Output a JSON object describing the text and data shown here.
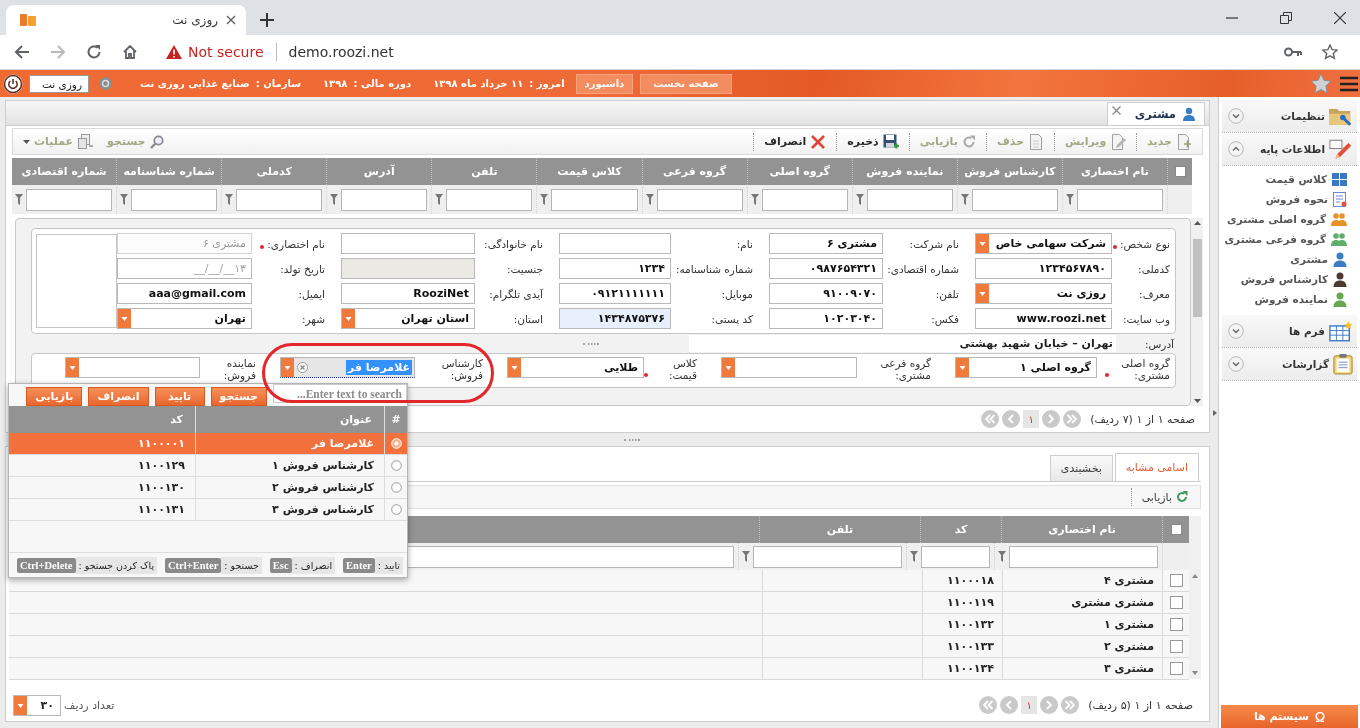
{
  "browser": {
    "tab_title": "روزی نت",
    "security": "Not secure",
    "url": "demo.roozi.net"
  },
  "header": {
    "buttons": [
      "صفحه نخست",
      "داشبورد"
    ],
    "info": [
      {
        "label": "امروز :",
        "value": "۱۱ خرداد ماه ۱۳۹۸"
      },
      {
        "label": "دوره مالی :",
        "value": "۱۳۹۸"
      },
      {
        "label": "سازمان :",
        "value": "صنایع غذایی روزی نت"
      }
    ],
    "company": "روزی نت"
  },
  "page_tab": {
    "label": "مشتری"
  },
  "toolbar": {
    "actions": [
      {
        "label": "جدید",
        "kind": "new",
        "disabled": true
      },
      {
        "label": "ویرایش",
        "kind": "edit",
        "disabled": true
      },
      {
        "label": "حذف",
        "kind": "delete",
        "disabled": true
      },
      {
        "label": "بازیابی",
        "kind": "restore",
        "disabled": true
      },
      {
        "label": "ذخیره",
        "kind": "save",
        "disabled": false
      },
      {
        "label": "انصراف",
        "kind": "cancel",
        "disabled": false
      }
    ],
    "tools": [
      {
        "label": "جستجو",
        "kind": "search",
        "disabled": true
      },
      {
        "label": "عملیات",
        "kind": "menu",
        "disabled": true
      }
    ]
  },
  "grid": {
    "all_checked": false,
    "columns": [
      "نام اختصاری",
      "کارشناس فروش",
      "نماینده فروش",
      "گروه اصلی",
      "گروه فرعی",
      "کلاس قیمت",
      "تلفن",
      "آدرس",
      "کدملی",
      "شماره شناسنامه",
      "شماره اقتصادی"
    ]
  },
  "form": {
    "rows": [
      [
        {
          "label": "نوع شخص:",
          "required": true,
          "kind": "select",
          "value": "شرکت سهامی خاص",
          "disabled": false,
          "autofilled": false
        },
        {
          "label": "نام شرکت:",
          "required": false,
          "kind": "text",
          "value": "مشتری ۶",
          "disabled": false,
          "autofilled": false
        },
        {
          "label": "نام:",
          "required": false,
          "kind": "text",
          "disabled": false,
          "autofilled": false
        },
        {
          "label": "نام خانوادگی:",
          "required": false,
          "kind": "text",
          "disabled": false,
          "autofilled": false
        },
        {
          "label": "نام اختصاری:",
          "required": true,
          "kind": "text",
          "value": "مشتری ۶",
          "disabled": true,
          "autofilled": false
        }
      ],
      [
        {
          "label": "کدملی:",
          "required": false,
          "kind": "text",
          "value": "۱۲۳۴۵۶۷۸۹۰",
          "disabled": false,
          "autofilled": false
        },
        {
          "label": "شماره اقتصادی:",
          "required": false,
          "kind": "text",
          "value": "۰۹۸۷۶۵۴۳۲۱",
          "disabled": false,
          "autofilled": false
        },
        {
          "label": "شماره شناسنامه:",
          "required": false,
          "kind": "text",
          "value": "۱۲۳۴",
          "disabled": false,
          "autofilled": false
        },
        {
          "label": "جنسیت:",
          "required": false,
          "kind": "select",
          "disabled": true,
          "autofilled": false
        },
        {
          "label": "تاریخ تولد:",
          "required": false,
          "kind": "text",
          "placeholder": "۱۳__/__/__",
          "disabled": false,
          "autofilled": false
        }
      ],
      [
        {
          "label": "معرف:",
          "required": false,
          "kind": "select",
          "value": "روزی نت",
          "disabled": false,
          "autofilled": false
        },
        {
          "label": "تلفن:",
          "required": false,
          "kind": "text",
          "value": "۹۱۰۰۹۰۷۰",
          "disabled": false,
          "autofilled": false
        },
        {
          "label": "موبایل:",
          "required": false,
          "kind": "text",
          "value": "۰۹۱۲۱۱۱۱۱۱۱",
          "disabled": false,
          "autofilled": false
        },
        {
          "label": "آیدی تلگرام:",
          "required": false,
          "kind": "text",
          "value": "RooziNet",
          "disabled": false,
          "autofilled": false
        },
        {
          "label": "ایمیل:",
          "required": false,
          "kind": "text",
          "value": "aaa@gmail.com",
          "disabled": false,
          "autofilled": false
        }
      ],
      [
        {
          "label": "وب سایت:",
          "required": false,
          "kind": "text",
          "value": "www.roozi.net",
          "disabled": false,
          "autofilled": false
        },
        {
          "label": "فکس:",
          "required": false,
          "kind": "text",
          "value": "۱۰۲۰۳۰۴۰",
          "disabled": false,
          "autofilled": false
        },
        {
          "label": "کد پستی:",
          "required": false,
          "kind": "text",
          "value": "۱۴۳۴۸۷۵۳۷۶",
          "disabled": false,
          "autofilled": true
        },
        {
          "label": "استان:",
          "required": false,
          "kind": "select",
          "value": "استان تهران",
          "disabled": false,
          "autofilled": false
        },
        {
          "label": "شهر:",
          "required": false,
          "kind": "select",
          "value": "تهران",
          "disabled": false,
          "autofilled": false
        }
      ]
    ],
    "address": {
      "label": "آدرس:",
      "value": "تهران – خیابان شهید بهشتی"
    },
    "groups": [
      {
        "label": "گروه اصلی مشتری:",
        "required": true,
        "kind": "select",
        "value": "گروه اصلی ۱",
        "focused": false
      },
      {
        "label": "گروه فرعی مشتری:",
        "required": false,
        "kind": "select",
        "focused": false
      },
      {
        "label": "کلاس قیمت:",
        "required": true,
        "kind": "select",
        "value": "طلایی",
        "focused": false
      },
      {
        "label": "کارشناس فروش:",
        "required": false,
        "kind": "combo",
        "value": "غلامرضا فر",
        "focused": true
      },
      {
        "label": "نماینده فروش:",
        "required": false,
        "kind": "select",
        "focused": false
      }
    ]
  },
  "pager": {
    "summary": "صفحه ۱ از ۱ (۷ ردیف)",
    "page": "۱"
  },
  "popup": {
    "search": {
      "placeholder": "Enter text to search..."
    },
    "buttons": [
      "جستجو",
      "تایید",
      "انصراف",
      "بازیابی"
    ],
    "columns": [
      "#",
      "عنوان",
      "کد"
    ],
    "rows": [
      {
        "title": "غلامرضا فر",
        "code": "۱۱۰۰۰۰۱",
        "selected": true
      },
      {
        "title": "کارشناس فروش ۱",
        "code": "۱۱۰۰۱۲۹",
        "selected": false
      },
      {
        "title": "کارشناس فروش ۲",
        "code": "۱۱۰۰۱۳۰",
        "selected": false
      },
      {
        "title": "کارشناس فروش ۳",
        "code": "۱۱۰۰۱۳۱",
        "selected": false
      }
    ],
    "shortcuts": [
      {
        "label": "تایید :",
        "key": "Enter"
      },
      {
        "label": "انصراف :",
        "key": "Esc"
      },
      {
        "label": "جستجو :",
        "key": "Ctrl+Enter"
      },
      {
        "label": "پاک کردن جستجو :",
        "key": "Ctrl+Delete"
      }
    ]
  },
  "lower": {
    "tabs": [
      {
        "label": "اسامی مشابه",
        "selected": true
      },
      {
        "label": "بخشبندی",
        "selected": false
      }
    ],
    "refresh": "بازیابی",
    "grid": {
      "all_checked": false,
      "columns": [
        "نام اختصاری",
        "کد",
        "تلفن"
      ],
      "rows": [
        {
          "name": "مشتری ۴",
          "code": "۱۱۰۰۰۱۸",
          "checked": false
        },
        {
          "name": "مشتری مشتری",
          "code": "۱۱۰۰۱۱۹",
          "checked": false
        },
        {
          "name": "مشتری ۱",
          "code": "۱۱۰۰۱۳۲",
          "checked": false
        },
        {
          "name": "مشتری ۲",
          "code": "۱۱۰۰۱۳۳",
          "checked": false
        },
        {
          "name": "مشتری ۳",
          "code": "۱۱۰۰۱۳۴",
          "checked": false
        }
      ]
    },
    "pager": {
      "summary": "صفحه ۱ از ۱ (۵ ردیف)",
      "page": "۱"
    },
    "page_size": {
      "label": "تعداد ردیف",
      "value": "۳۰"
    }
  },
  "sidebar": {
    "sections": [
      {
        "title": "تنظیمات",
        "kind": "settings",
        "expanded": false
      },
      {
        "title": "اطلاعات پایه",
        "kind": "base",
        "expanded": true,
        "items": [
          {
            "label": "کلاس قیمت",
            "kind": "table"
          },
          {
            "label": "نحوه فروش",
            "kind": "list"
          },
          {
            "label": "گروه اصلی مشتری",
            "kind": "group"
          },
          {
            "label": "گروه فرعی مشتری",
            "kind": "subgroup"
          },
          {
            "label": "مشتری",
            "kind": "customer"
          },
          {
            "label": "کارشناس فروش",
            "kind": "expert"
          },
          {
            "label": "نماینده فروش",
            "kind": "agent"
          }
        ]
      },
      {
        "title": "فرم ها",
        "kind": "forms",
        "expanded": false
      },
      {
        "title": "گزارشات",
        "kind": "reports",
        "expanded": false
      }
    ],
    "systems_button": "سیستم ها"
  }
}
